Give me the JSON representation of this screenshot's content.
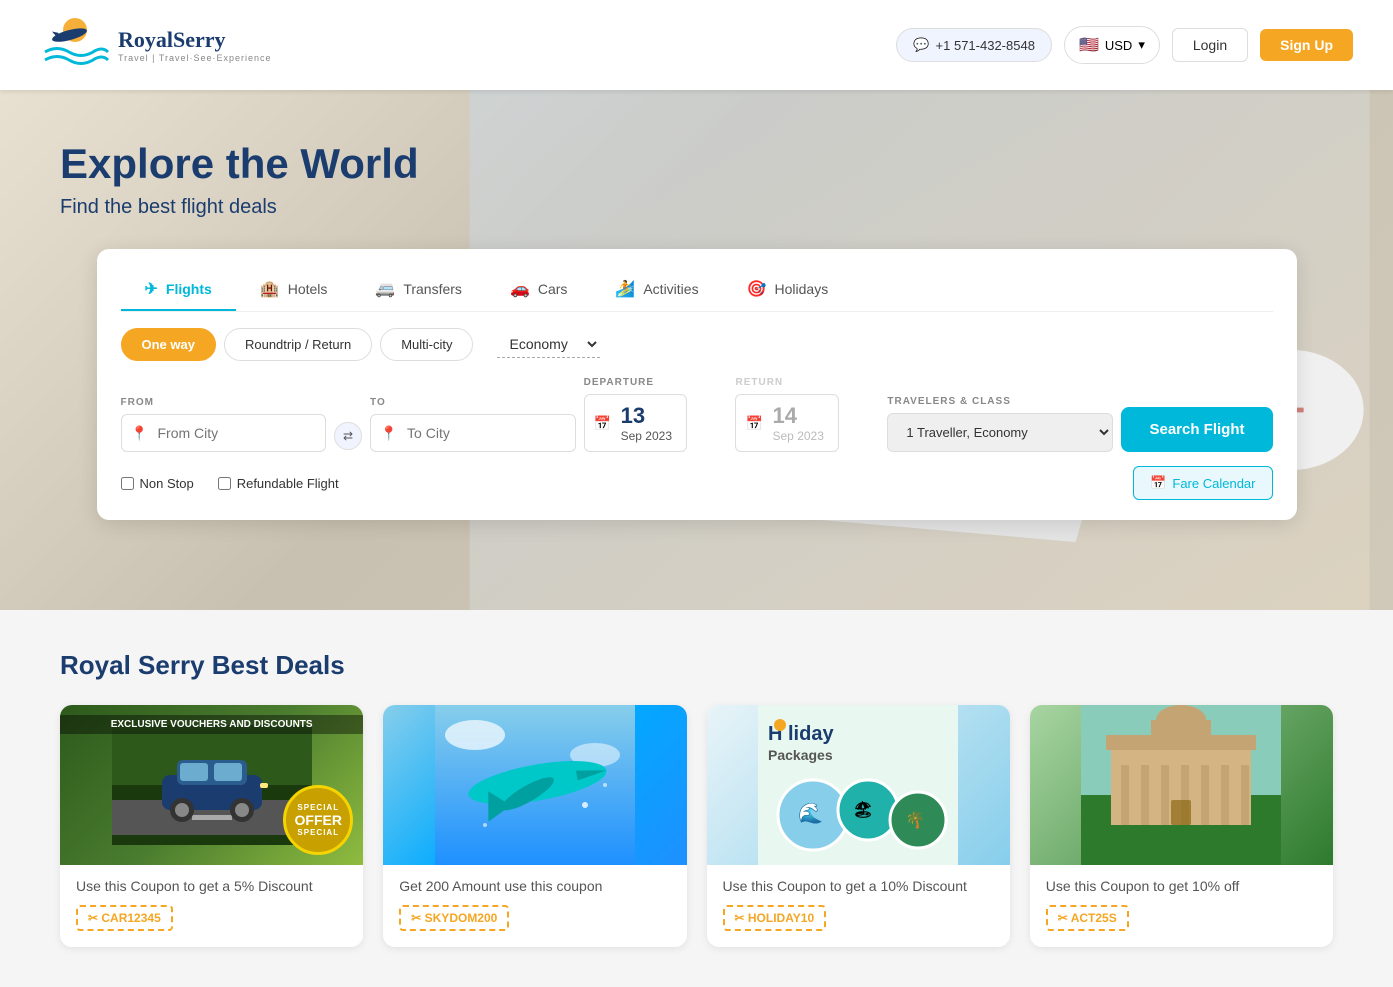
{
  "header": {
    "logo_main": "RoyalSerry",
    "logo_sub": "Travel | Travel·See·Experience",
    "phone": "+1 571-432-8548",
    "currency": "USD",
    "login_label": "Login",
    "signup_label": "Sign Up"
  },
  "hero": {
    "title": "Explore the World",
    "subtitle": "Find the best flight deals"
  },
  "tabs": [
    {
      "label": "Flights",
      "icon": "✈"
    },
    {
      "label": "Hotels",
      "icon": "🏨"
    },
    {
      "label": "Transfers",
      "icon": "🚐"
    },
    {
      "label": "Cars",
      "icon": "🚗"
    },
    {
      "label": "Activities",
      "icon": "🏄"
    },
    {
      "label": "Holidays",
      "icon": "🎯"
    }
  ],
  "trip_types": {
    "one_way": "One way",
    "roundtrip": "Roundtrip / Return",
    "multi_city": "Multi-city",
    "economy": "Economy"
  },
  "search": {
    "from_label": "FROM",
    "to_label": "TO",
    "departure_label": "DEPARTURE",
    "return_label": "RETURN",
    "travelers_label": "TRAVELERS & CLASS",
    "from_placeholder": "From City",
    "to_placeholder": "To City",
    "departure_day": "13",
    "departure_month": "Sep",
    "departure_year": "2023",
    "return_day": "14",
    "return_month": "Sep",
    "return_year": "2023",
    "travelers_value": "1 Traveller, Economy",
    "search_btn": "Search Flight",
    "non_stop": "Non Stop",
    "refundable": "Refundable Flight",
    "fare_calendar": "Fare Calendar"
  },
  "deals": {
    "section_title": "Royal Serry Best Deals",
    "cards": [
      {
        "type": "car",
        "badge_top": "EXCLUSIVE VOUCHERS AND DISCOUNTS",
        "badge_stamp": "OFFER",
        "text": "Use this Coupon to get a 5% Discount",
        "coupon": "✂ CAR12345"
      },
      {
        "type": "flight",
        "text": "Get 200 Amount use this coupon",
        "coupon": "✂ SKYDOM200"
      },
      {
        "type": "holiday",
        "text": "Use this Coupon to get a 10% Discount",
        "coupon": "✂ HOLIDAY10"
      },
      {
        "type": "building",
        "text": "Use this Coupon to get 10% off",
        "coupon": "✂ ACT25S"
      }
    ]
  }
}
